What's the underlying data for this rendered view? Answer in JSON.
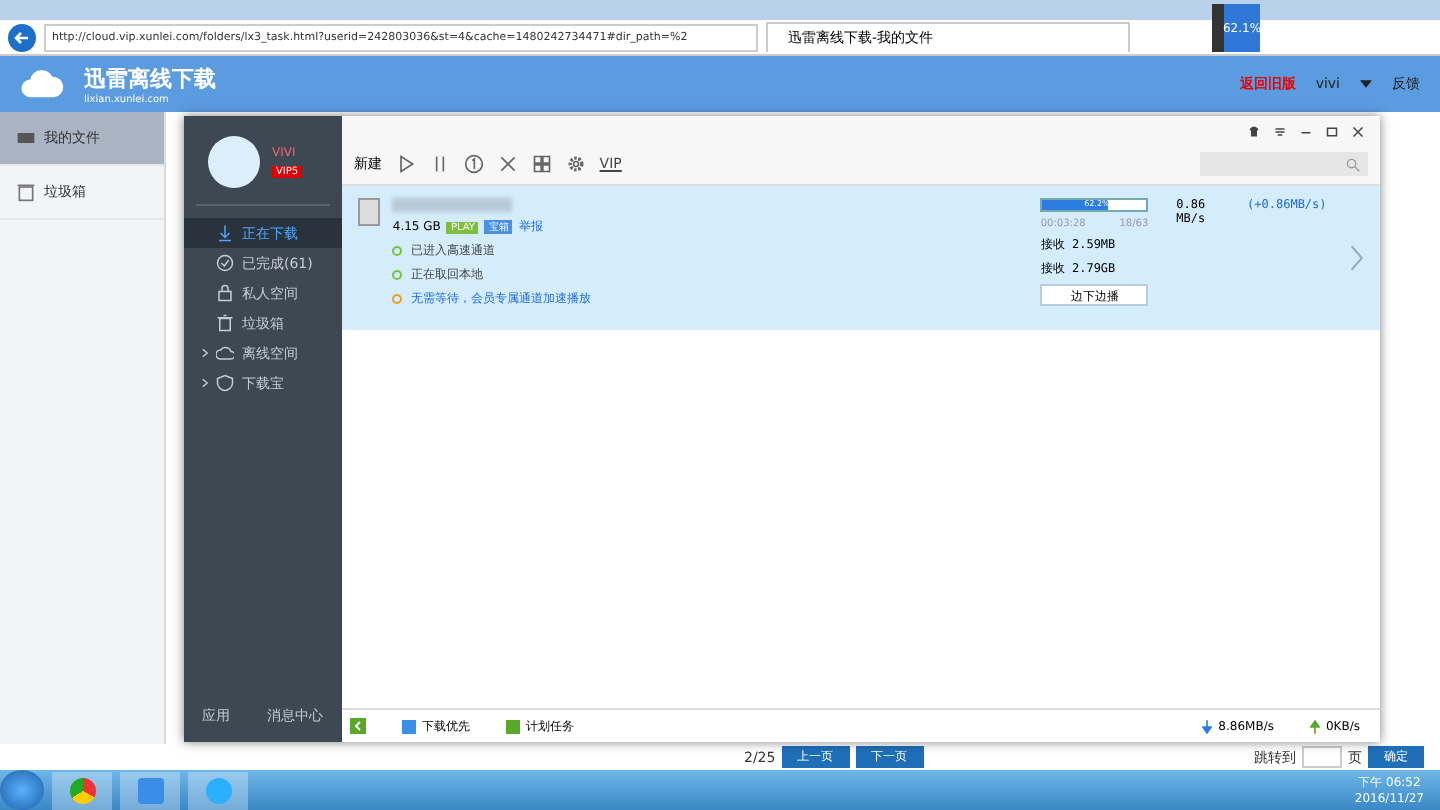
{
  "browser": {
    "address": "http://cloud.vip.xunlei.com/folders/lx3_task.html?userid=242803036&st=4&cache=1480242734471#dir_path=%2",
    "tab_title": "迅雷离线下载-我的文件",
    "zoom_badge": "62.1%"
  },
  "site_header": {
    "logo_title": "迅雷离线下载",
    "logo_subtitle": "lixian.xunlei.com",
    "old_version_link": "返回旧版",
    "user": "vivi",
    "feedback": "反馈"
  },
  "site_sidebar": [
    {
      "label": "我的文件",
      "selected": true
    },
    {
      "label": "垃圾箱",
      "selected": false
    }
  ],
  "pager": {
    "page": "2/25",
    "prev": "上一页",
    "next": "下一页",
    "jump_label": "跳转到",
    "page_unit": "页",
    "confirm": "确定"
  },
  "taskbar": {
    "time": "下午 06:52",
    "date": "2016/11/27"
  },
  "app": {
    "username": "VIVI",
    "vip_badge": "VIP5",
    "nav": [
      {
        "label": "正在下载",
        "selected": true,
        "expandable": false
      },
      {
        "label": "已完成(61)",
        "selected": false,
        "expandable": false
      },
      {
        "label": "私人空间",
        "selected": false,
        "expandable": false
      },
      {
        "label": "垃圾箱",
        "selected": false,
        "expandable": false
      },
      {
        "label": "离线空间",
        "selected": false,
        "expandable": true
      },
      {
        "label": "下载宝",
        "selected": false,
        "expandable": true
      }
    ],
    "footer_links": [
      "应用",
      "消息中心"
    ],
    "toolbar": {
      "new_label": "新建",
      "vip_label": "VIP"
    },
    "task": {
      "size": "4.15 GB",
      "play_tag": "PLAY",
      "treasure_tag": "宝箱",
      "report_link": "举报",
      "statuses": [
        {
          "text": "已进入高速通道",
          "color": "#7cc13a"
        },
        {
          "text": "正在取回本地",
          "color": "#7cc13a"
        },
        {
          "text": "无需等待，会员专属通道加速播放",
          "color": "#f0a020"
        }
      ],
      "level": 0.622,
      "progress_text": "62.2%",
      "elapsed": "00:03:28",
      "pieces": "18/63",
      "speed": "0.86 MB/s",
      "speed_boost": "(+0.86MB/s)",
      "received_1": "接收 2.59MB",
      "received_2": "接收 2.79GB",
      "play_button": "边下边播"
    },
    "bottom": {
      "priority": "下载优先",
      "schedule": "计划任务",
      "down_speed": "8.86MB/s",
      "up_speed": "0KB/s"
    }
  }
}
